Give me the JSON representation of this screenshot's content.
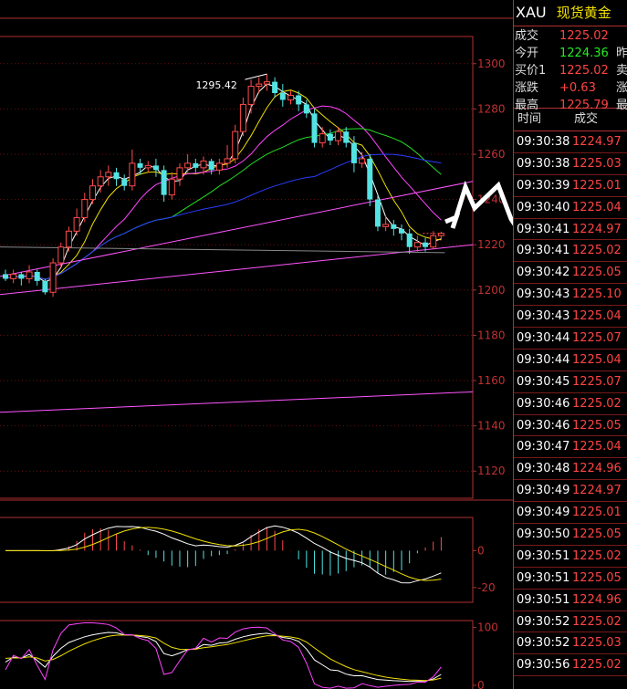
{
  "symbol": "XAU",
  "instrument_name": "现货黄金",
  "quotes": [
    {
      "label": "成交",
      "value": "1225.02",
      "color": "red",
      "extra": ""
    },
    {
      "label": "今开",
      "value": "1224.36",
      "color": "green",
      "extra": "昨"
    },
    {
      "label": "买价1",
      "value": "1225.02",
      "color": "red",
      "extra": "卖"
    },
    {
      "label": "涨跌",
      "value": "+0.63",
      "color": "red",
      "extra": "涨"
    },
    {
      "label": "最高",
      "value": "1225.79",
      "color": "red",
      "extra": "最"
    }
  ],
  "ticks_header": {
    "time": "时间",
    "price": "成交"
  },
  "ticks": [
    {
      "time": "09:30:38",
      "price": "1224.97"
    },
    {
      "time": "09:30:38",
      "price": "1225.03"
    },
    {
      "time": "09:30:39",
      "price": "1225.01"
    },
    {
      "time": "09:30:40",
      "price": "1225.04"
    },
    {
      "time": "09:30:41",
      "price": "1224.97"
    },
    {
      "time": "09:30:41",
      "price": "1225.02"
    },
    {
      "time": "09:30:42",
      "price": "1225.05"
    },
    {
      "time": "09:30:43",
      "price": "1225.10"
    },
    {
      "time": "09:30:43",
      "price": "1225.04"
    },
    {
      "time": "09:30:44",
      "price": "1225.07"
    },
    {
      "time": "09:30:44",
      "price": "1225.04"
    },
    {
      "time": "09:30:45",
      "price": "1225.07"
    },
    {
      "time": "09:30:46",
      "price": "1225.02"
    },
    {
      "time": "09:30:46",
      "price": "1225.05"
    },
    {
      "time": "09:30:47",
      "price": "1225.04"
    },
    {
      "time": "09:30:48",
      "price": "1224.96"
    },
    {
      "time": "09:30:49",
      "price": "1224.97"
    },
    {
      "time": "09:30:49",
      "price": "1225.01"
    },
    {
      "time": "09:30:50",
      "price": "1225.05"
    },
    {
      "time": "09:30:51",
      "price": "1225.02"
    },
    {
      "time": "09:30:51",
      "price": "1225.05"
    },
    {
      "time": "09:30:51",
      "price": "1224.96"
    },
    {
      "time": "09:30:52",
      "price": "1225.02"
    },
    {
      "time": "09:30:52",
      "price": "1225.03"
    },
    {
      "time": "09:30:56",
      "price": "1225.02"
    }
  ],
  "chart_data": [
    {
      "type": "candlestick",
      "annotation": {
        "text": "1295.42",
        "value": 1295.42
      },
      "yticks": [
        1120,
        1140,
        1160,
        1180,
        1200,
        1220,
        1240,
        1260,
        1280,
        1300
      ],
      "ylim": [
        1108,
        1312
      ],
      "candles": [
        {
          "o": 1207,
          "c": 1205,
          "h": 1209,
          "l": 1204
        },
        {
          "o": 1205,
          "c": 1207,
          "h": 1209,
          "l": 1203
        },
        {
          "o": 1207,
          "c": 1205,
          "h": 1208,
          "l": 1202
        },
        {
          "o": 1205,
          "c": 1208,
          "h": 1211,
          "l": 1203
        },
        {
          "o": 1208,
          "c": 1204,
          "h": 1209,
          "l": 1202
        },
        {
          "o": 1204,
          "c": 1199,
          "h": 1205,
          "l": 1198
        },
        {
          "o": 1199,
          "c": 1212,
          "h": 1214,
          "l": 1197
        },
        {
          "o": 1212,
          "c": 1219,
          "h": 1221,
          "l": 1210
        },
        {
          "o": 1219,
          "c": 1226,
          "h": 1228,
          "l": 1217
        },
        {
          "o": 1226,
          "c": 1232,
          "h": 1236,
          "l": 1224
        },
        {
          "o": 1232,
          "c": 1240,
          "h": 1243,
          "l": 1230
        },
        {
          "o": 1240,
          "c": 1246,
          "h": 1249,
          "l": 1238
        },
        {
          "o": 1246,
          "c": 1250,
          "h": 1253,
          "l": 1243
        },
        {
          "o": 1250,
          "c": 1252,
          "h": 1255,
          "l": 1246
        },
        {
          "o": 1252,
          "c": 1249,
          "h": 1254,
          "l": 1246
        },
        {
          "o": 1249,
          "c": 1246,
          "h": 1251,
          "l": 1244
        },
        {
          "o": 1246,
          "c": 1256,
          "h": 1262,
          "l": 1244
        },
        {
          "o": 1256,
          "c": 1254,
          "h": 1258,
          "l": 1251
        },
        {
          "o": 1254,
          "c": 1255,
          "h": 1257,
          "l": 1252
        },
        {
          "o": 1255,
          "c": 1253,
          "h": 1258,
          "l": 1250
        },
        {
          "o": 1253,
          "c": 1242,
          "h": 1255,
          "l": 1239
        },
        {
          "o": 1242,
          "c": 1249,
          "h": 1252,
          "l": 1240
        },
        {
          "o": 1249,
          "c": 1254,
          "h": 1256,
          "l": 1246
        },
        {
          "o": 1254,
          "c": 1256,
          "h": 1260,
          "l": 1252
        },
        {
          "o": 1256,
          "c": 1254,
          "h": 1258,
          "l": 1252
        },
        {
          "o": 1254,
          "c": 1257,
          "h": 1259,
          "l": 1251
        },
        {
          "o": 1257,
          "c": 1253,
          "h": 1258,
          "l": 1251
        },
        {
          "o": 1253,
          "c": 1256,
          "h": 1258,
          "l": 1251
        },
        {
          "o": 1256,
          "c": 1258,
          "h": 1264,
          "l": 1254
        },
        {
          "o": 1258,
          "c": 1270,
          "h": 1273,
          "l": 1256
        },
        {
          "o": 1270,
          "c": 1282,
          "h": 1285,
          "l": 1268
        },
        {
          "o": 1282,
          "c": 1290,
          "h": 1293,
          "l": 1278
        },
        {
          "o": 1290,
          "c": 1291,
          "h": 1294,
          "l": 1287
        },
        {
          "o": 1291,
          "c": 1292,
          "h": 1295.42,
          "l": 1288
        },
        {
          "o": 1292,
          "c": 1287,
          "h": 1294,
          "l": 1285
        },
        {
          "o": 1287,
          "c": 1284,
          "h": 1291,
          "l": 1281
        },
        {
          "o": 1284,
          "c": 1286,
          "h": 1288,
          "l": 1282
        },
        {
          "o": 1286,
          "c": 1282,
          "h": 1288,
          "l": 1279
        },
        {
          "o": 1282,
          "c": 1278,
          "h": 1284,
          "l": 1276
        },
        {
          "o": 1278,
          "c": 1265,
          "h": 1280,
          "l": 1263
        },
        {
          "o": 1265,
          "c": 1269,
          "h": 1272,
          "l": 1263
        },
        {
          "o": 1269,
          "c": 1266,
          "h": 1271,
          "l": 1264
        },
        {
          "o": 1266,
          "c": 1270,
          "h": 1272,
          "l": 1264
        },
        {
          "o": 1270,
          "c": 1265,
          "h": 1272,
          "l": 1263
        },
        {
          "o": 1265,
          "c": 1256,
          "h": 1268,
          "l": 1252
        },
        {
          "o": 1256,
          "c": 1258,
          "h": 1261,
          "l": 1254
        },
        {
          "o": 1258,
          "c": 1240,
          "h": 1260,
          "l": 1237
        },
        {
          "o": 1240,
          "c": 1228,
          "h": 1242,
          "l": 1226
        },
        {
          "o": 1228,
          "c": 1229,
          "h": 1233,
          "l": 1226
        },
        {
          "o": 1229,
          "c": 1227,
          "h": 1231,
          "l": 1224
        },
        {
          "o": 1227,
          "c": 1225,
          "h": 1229,
          "l": 1222
        },
        {
          "o": 1225,
          "c": 1219,
          "h": 1227,
          "l": 1216
        },
        {
          "o": 1219,
          "c": 1221,
          "h": 1224,
          "l": 1217
        },
        {
          "o": 1221,
          "c": 1219,
          "h": 1223,
          "l": 1217
        },
        {
          "o": 1219,
          "c": 1224,
          "h": 1226,
          "l": 1218
        },
        {
          "o": 1224,
          "c": 1225.02,
          "h": 1225.79,
          "l": 1222
        }
      ]
    },
    {
      "type": "bar",
      "yticks": [
        0,
        -20
      ],
      "ylim": [
        -28,
        18
      ]
    },
    {
      "type": "line",
      "yticks": [
        100,
        0
      ],
      "ylim": [
        -8,
        112
      ]
    }
  ]
}
